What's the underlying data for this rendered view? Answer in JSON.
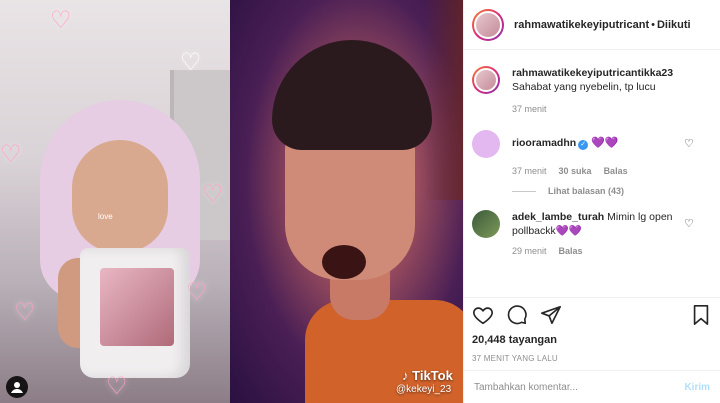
{
  "header": {
    "username": "rahmawatikekeyiputricant",
    "separator": "•",
    "follow_label": "Diikuti"
  },
  "caption": {
    "username": "rahmawatikekeyiputricantikka23",
    "text": "Sahabat yang nyebelin, tp lucu",
    "time": "37 menit"
  },
  "comments": [
    {
      "username": "riooramadhn",
      "verified": true,
      "text": "💜💜",
      "time": "37 menit",
      "likes": "30 suka",
      "reply_label": "Balas",
      "view_replies": "Lihat balasan (43)"
    },
    {
      "username": "adek_lambe_turah",
      "verified": false,
      "text": "Mimin lg open pollbackk💜💜",
      "time": "29 menit",
      "reply_label": "Balas"
    }
  ],
  "stats": {
    "views": "20,448 tayangan",
    "date": "37 MENIT YANG LALU"
  },
  "add_comment": {
    "placeholder": "Tambahkan komentar...",
    "send_label": "Kirim"
  },
  "video": {
    "watermark_app": "TikTok",
    "watermark_user": "@kekeyi_23",
    "sticker_text": "love"
  },
  "colors": {
    "verified": "#3897f0",
    "muted": "#8e8e8e",
    "send_disabled": "#b2dffc"
  }
}
